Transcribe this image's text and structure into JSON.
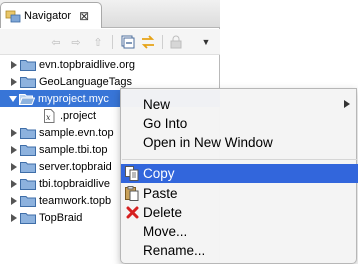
{
  "view": {
    "tab_title": "Navigator",
    "tab_close": "⊠",
    "toolbar": {
      "back_icon": "⇦",
      "forward_icon": "⇨",
      "up_icon": "⇧",
      "collapse_icon": "⊟",
      "link_icon": "⇆",
      "lock_icon": "🔒",
      "menu_icon": "▼"
    }
  },
  "tree": {
    "items": [
      {
        "label": "evn.topbraidlive.org"
      },
      {
        "label": "GeoLanguageTags"
      },
      {
        "label": "myproject.myc"
      },
      {
        "label": ".project"
      },
      {
        "label": "sample.evn.top"
      },
      {
        "label": "sample.tbi.top"
      },
      {
        "label": "server.topbraid"
      },
      {
        "label": "tbi.topbraidlive"
      },
      {
        "label": "teamwork.topb"
      },
      {
        "label": "TopBraid"
      }
    ]
  },
  "menu": {
    "items": [
      {
        "label": "New"
      },
      {
        "label": "Go Into"
      },
      {
        "label": "Open in New Window"
      },
      {
        "label": "Copy"
      },
      {
        "label": "Paste"
      },
      {
        "label": "Delete"
      },
      {
        "label": "Move..."
      },
      {
        "label": "Rename..."
      }
    ]
  },
  "colors": {
    "selection": "#3875d7",
    "menu_highlight": "#3266dc",
    "folder": "#7fa7d6"
  }
}
